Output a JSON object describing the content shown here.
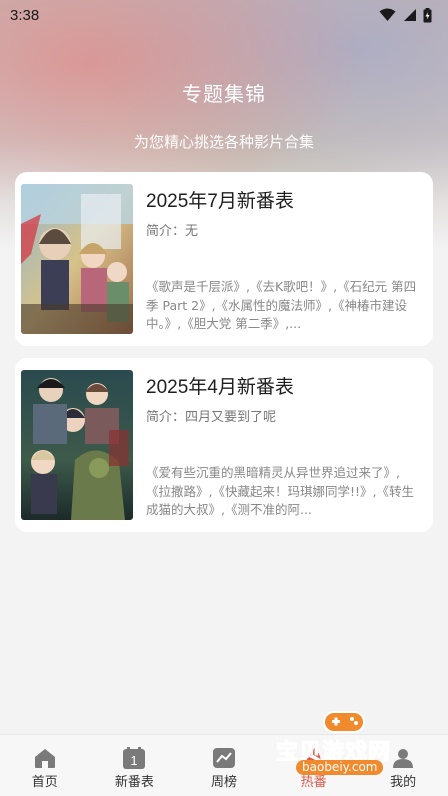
{
  "status_bar": {
    "time": "3:38"
  },
  "header": {
    "title": "专题集锦",
    "subtitle": "为您精心挑选各种影片合集"
  },
  "collections": [
    {
      "title": "2025年7月新番表",
      "intro": "简介：无",
      "description": "《歌声是千层派》,《去K歌吧！》,《石纪元 第四季 Part 2》,《水属性的魔法师》,《神椿市建设中。》,《胆大党 第二季》,..."
    },
    {
      "title": "2025年4月新番表",
      "intro": "简介：四月又要到了呢",
      "description": "《爱有些沉重的黑暗精灵从异世界追过来了》,《拉撒路》,《快藏起来！玛琪娜同学!!》,《转生成猫的大叔》,《测不准的阿..."
    }
  ],
  "nav": {
    "items": [
      {
        "label": "首页",
        "icon": "home-icon"
      },
      {
        "label": "新番表",
        "icon": "calendar-icon",
        "badge": "1"
      },
      {
        "label": "周榜",
        "icon": "chart-icon"
      },
      {
        "label": "热番",
        "icon": "fire-icon"
      },
      {
        "label": "我的",
        "icon": "profile-icon"
      }
    ],
    "active_index": 3,
    "active_color": "#e0584a"
  },
  "watermark": {
    "text": "宝贝游戏网",
    "url": "baobeiy.com"
  }
}
